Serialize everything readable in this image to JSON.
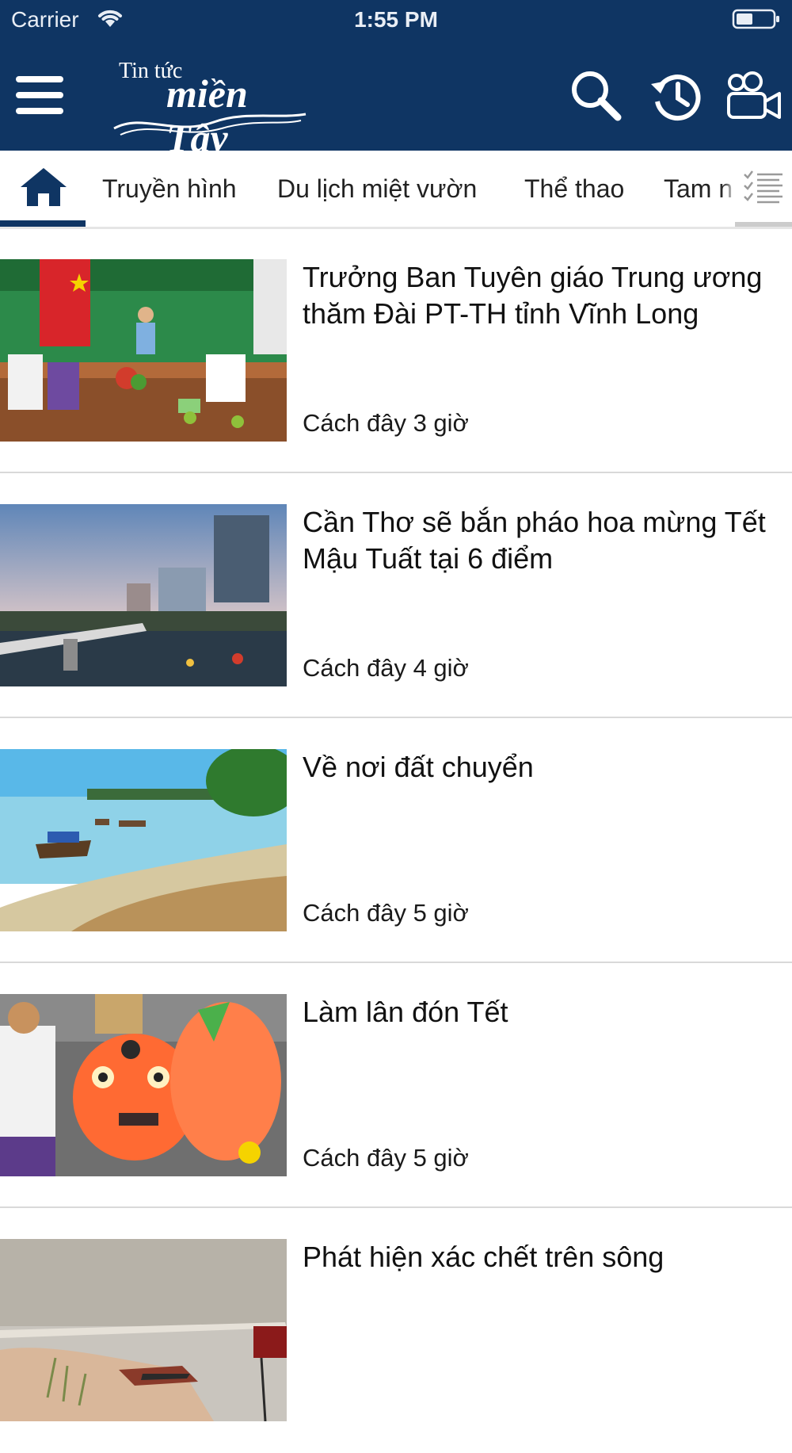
{
  "status_bar": {
    "carrier": "Carrier",
    "time": "1:55 PM"
  },
  "header": {
    "logo_small": "Tin tức",
    "logo_big": "miền Tây",
    "icons": [
      "menu-icon",
      "search-icon",
      "history-icon",
      "video-camera-icon"
    ],
    "background": "#0f3563"
  },
  "tabs": [
    {
      "label": "Truyền hình"
    },
    {
      "label": "Du lịch miệt vườn"
    },
    {
      "label": "Thể thao"
    },
    {
      "label": "Tam n"
    }
  ],
  "articles": [
    {
      "title": "Trưởng Ban Tuyên giáo Trung ương thăm Đài PT-TH tỉnh Vĩnh Long",
      "time": "Cách đây 3 giờ"
    },
    {
      "title": "Cần Thơ sẽ bắn pháo hoa mừng Tết Mậu Tuất tại 6 điểm",
      "time": "Cách đây 4 giờ"
    },
    {
      "title": "Về nơi đất chuyển",
      "time": "Cách đây 5 giờ"
    },
    {
      "title": "Làm lân đón Tết",
      "time": "Cách đây 5 giờ"
    },
    {
      "title": "Phát hiện xác chết trên sông",
      "time": ""
    }
  ],
  "colors": {
    "accent": "#0f3563",
    "divider": "#d9d9d9"
  }
}
